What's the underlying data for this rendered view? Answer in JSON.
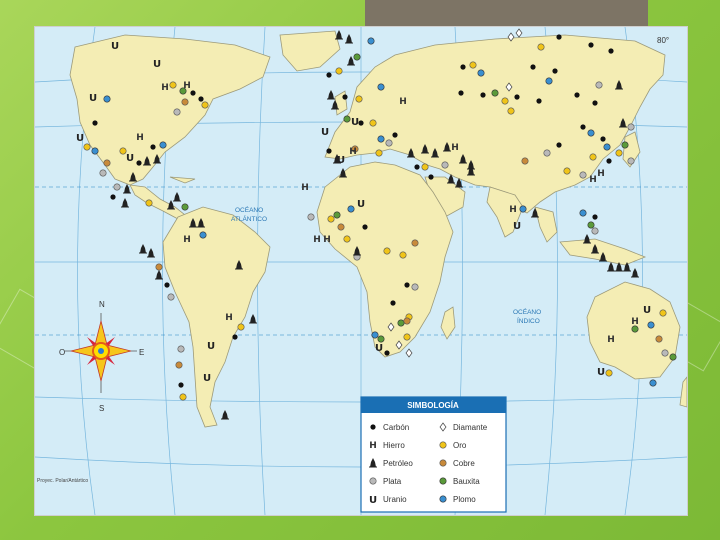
{
  "map": {
    "corner_label": "80°",
    "ocean_atlantic": [
      "OCÉANO",
      "ATLÁNTICO"
    ],
    "ocean_indian": [
      "OCÉANO",
      "ÍNDICO"
    ],
    "source_note": "Proyec. Polar/Antártico",
    "compass": {
      "north": "N",
      "south": "S",
      "east": "E",
      "west": "O"
    }
  },
  "legend": {
    "title": "SIMBOLOGÍA",
    "items": [
      {
        "label": "Carbón",
        "symbol": "carbon",
        "color": "#111111"
      },
      {
        "label": "Hierro",
        "symbol": "hierro",
        "color": "#222222"
      },
      {
        "label": "Petróleo",
        "symbol": "petroleo",
        "color": "#222222"
      },
      {
        "label": "Plata",
        "symbol": "plata",
        "color": "#b9b9b9"
      },
      {
        "label": "Uranio",
        "symbol": "uranio",
        "color": "#2c2c2c"
      },
      {
        "label": "Diamante",
        "symbol": "diamante",
        "color": "#ffffff"
      },
      {
        "label": "Oro",
        "symbol": "oro",
        "color": "#f0c419"
      },
      {
        "label": "Cobre",
        "symbol": "cobre",
        "color": "#c88a3a"
      },
      {
        "label": "Bauxita",
        "symbol": "bauxita",
        "color": "#5a9a3a"
      },
      {
        "label": "Plomo",
        "symbol": "plomo",
        "color": "#3a8fd0"
      }
    ]
  },
  "colors": {
    "ocean": "#d4ecf7",
    "land": "#f4edb4",
    "grid": "#2b8bc9",
    "legend_header": "#1a6fb4"
  }
}
